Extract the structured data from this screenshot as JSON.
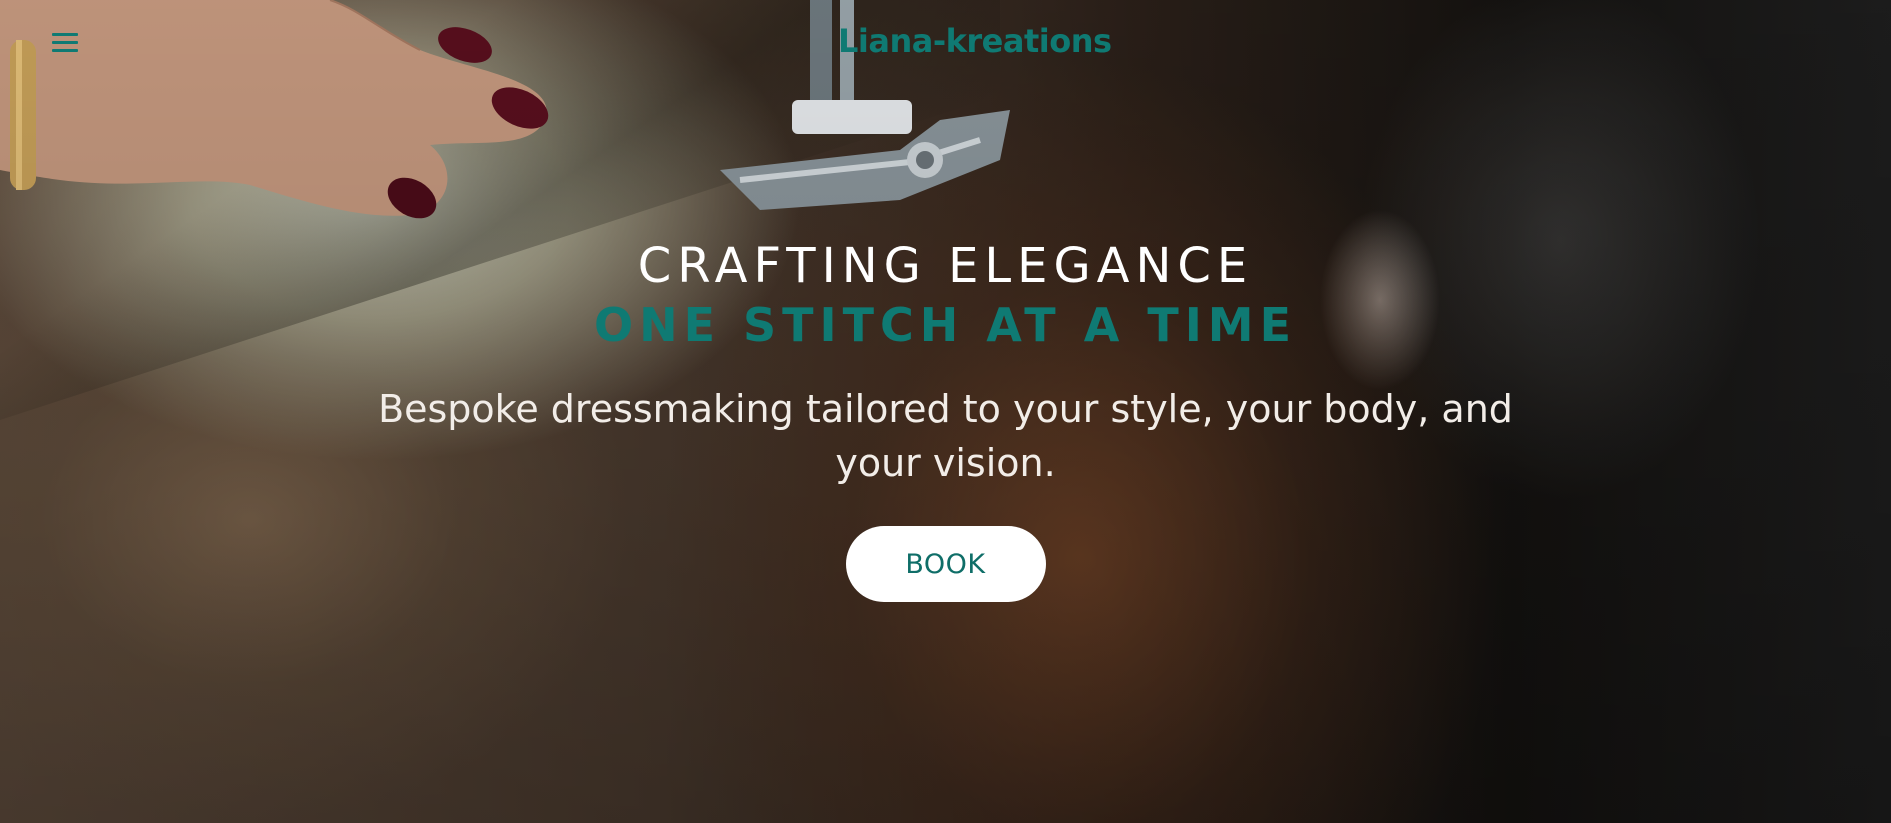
{
  "header": {
    "menu_icon": "hamburger-menu-icon",
    "logo_text": "Liana-kreations"
  },
  "hero": {
    "headline_line1": "CRAFTING ELEGANCE",
    "headline_line2": "ONE STITCH AT A TIME",
    "subtitle": "Bespoke dressmaking tailored to your style, your body, and your vision.",
    "cta_label": "BOOK"
  },
  "colors": {
    "accent": "#0f7a73",
    "text_light": "#ffffff",
    "button_bg": "#ffffff"
  }
}
